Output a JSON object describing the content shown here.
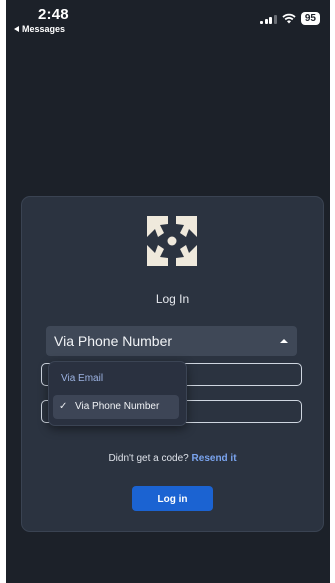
{
  "status_bar": {
    "time": "2:48",
    "back_app": "Messages",
    "battery": "95",
    "icons": [
      "cellular-signal-icon",
      "wifi-icon",
      "battery-icon"
    ]
  },
  "login": {
    "title": "Log In",
    "method_select": {
      "selected": "Via Phone Number",
      "options": [
        "Via Email",
        "Via Phone Number"
      ]
    },
    "resend_prompt": "Didn't get a code?",
    "resend_link": "Resend it",
    "submit_label": "Log in"
  },
  "colors": {
    "background": "#1c2129",
    "card": "#2b3340",
    "primary_button": "#1b63d2",
    "link": "#7aa4ef",
    "menu_email_text": "#9cb3e2"
  }
}
